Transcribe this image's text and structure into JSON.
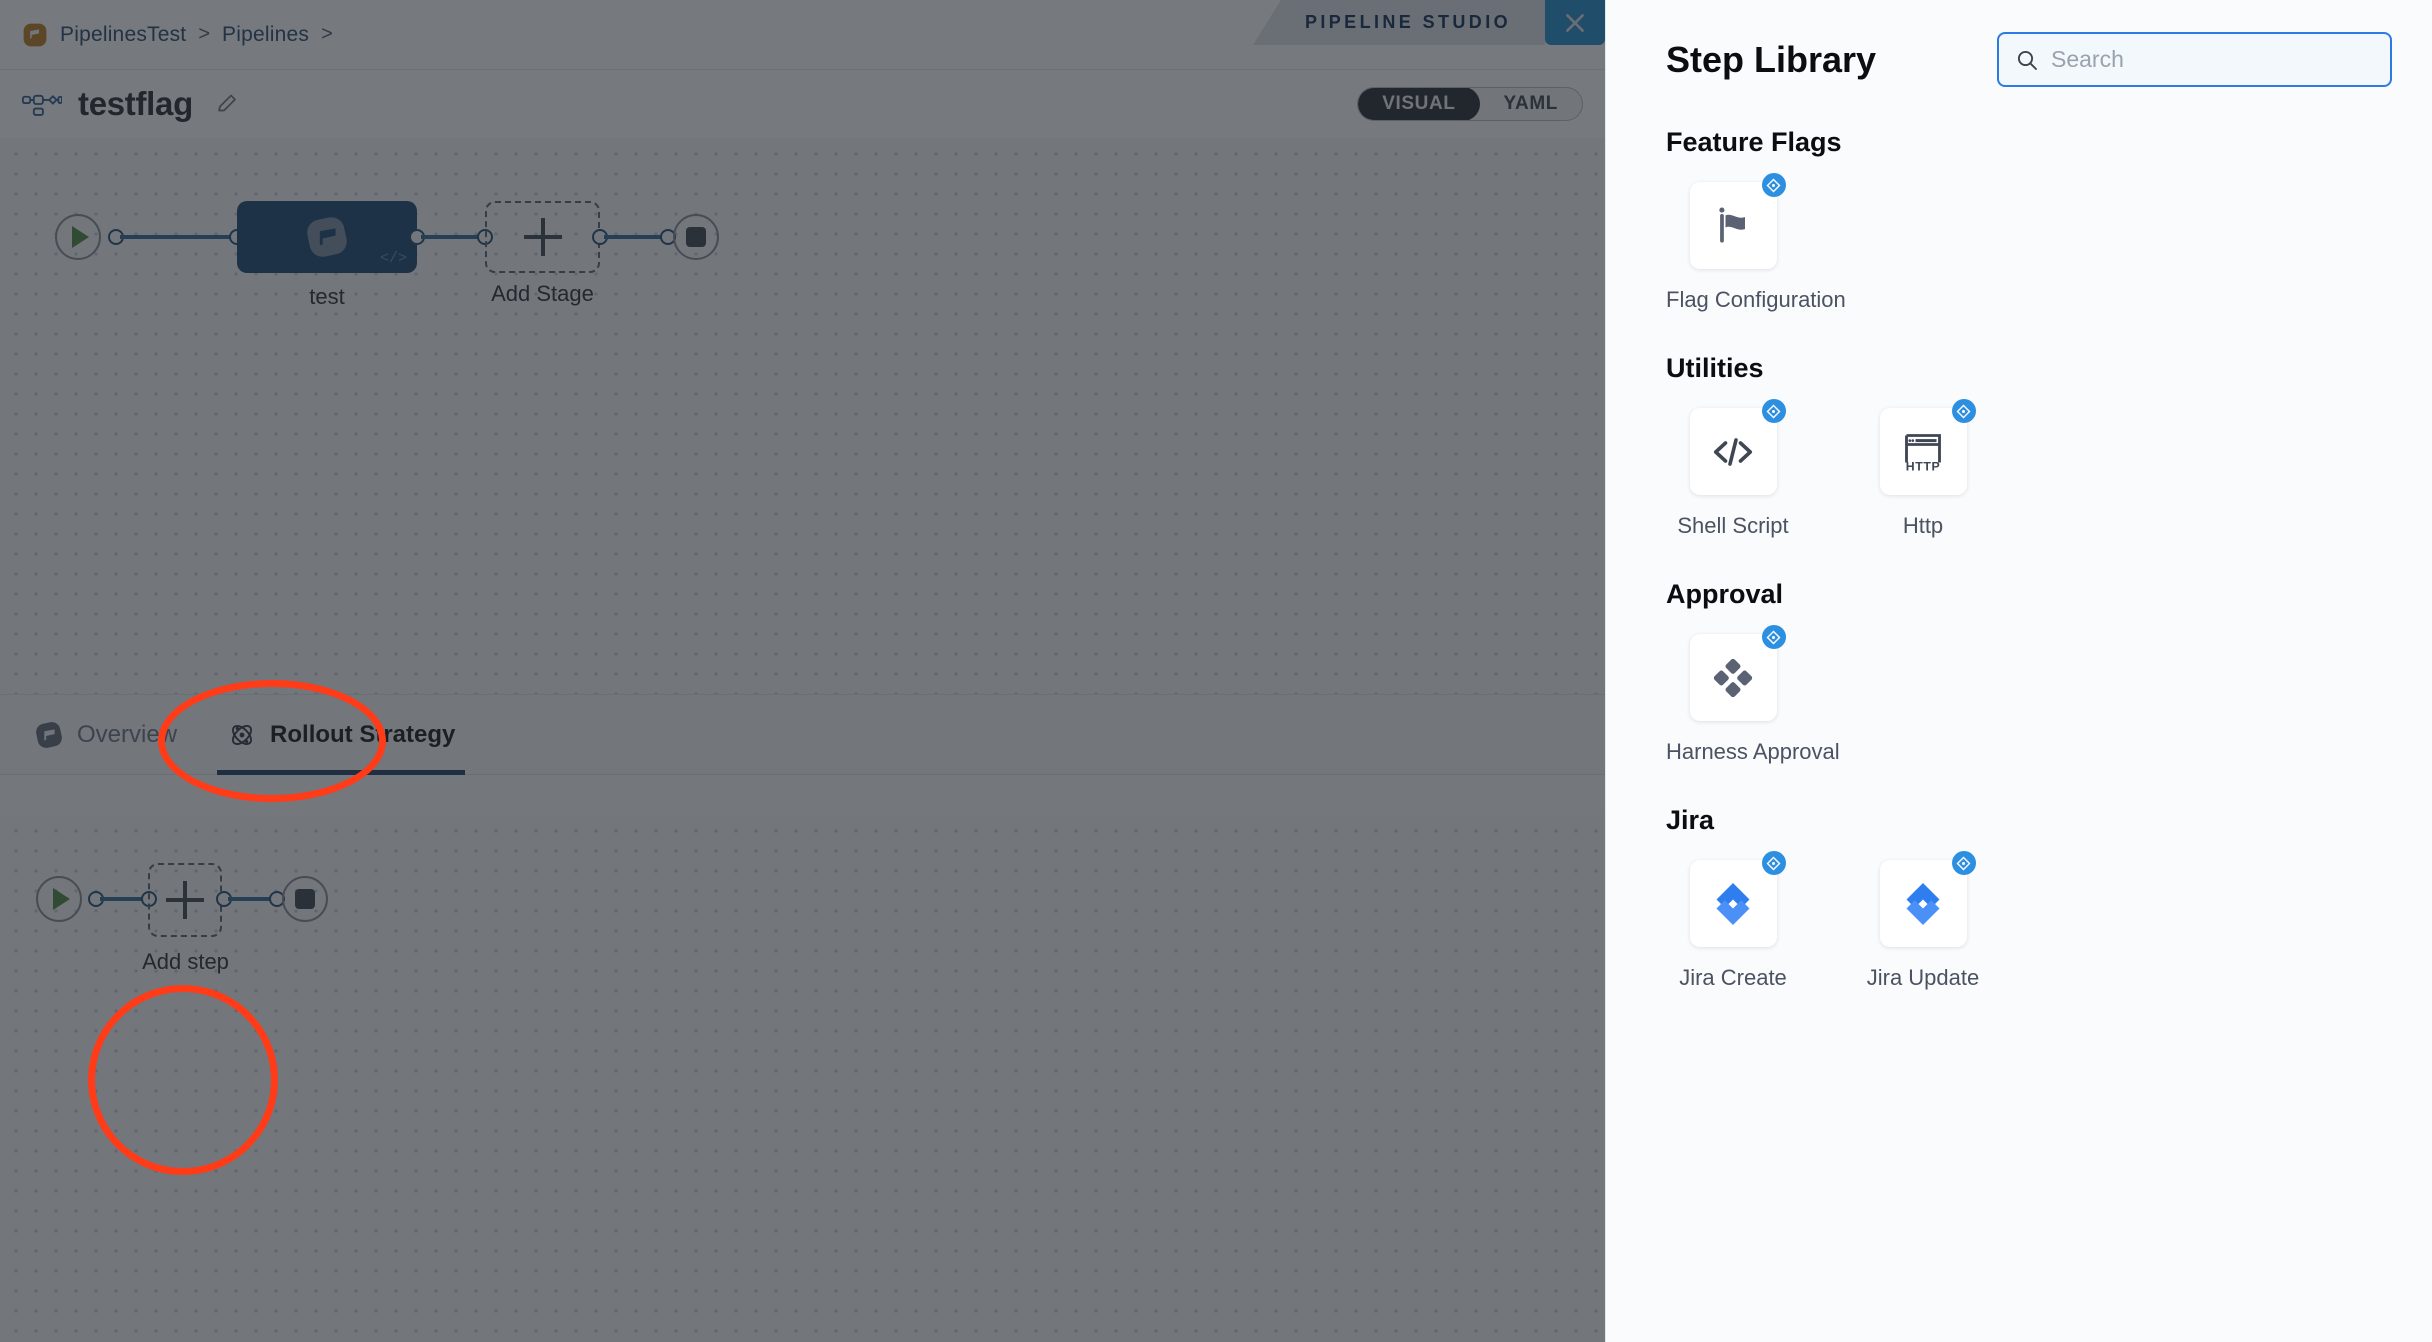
{
  "breadcrumb": {
    "logo_icon": "harness-logo-icon",
    "items": [
      "PipelinesTest",
      "Pipelines"
    ],
    "separator": ">",
    "trailing_separator": ">"
  },
  "studio_tag": {
    "label": "PIPELINE STUDIO",
    "close_icon": "close-icon",
    "close_bg": "#1e8ccb"
  },
  "title_row": {
    "pipeline_icon": "pipeline-nodes-icon",
    "name": "testflag",
    "edit_icon": "pencil-icon",
    "view_toggle": {
      "options": [
        "VISUAL",
        "YAML"
      ],
      "selected": "VISUAL"
    }
  },
  "stage_canvas": {
    "start_icon": "play-icon",
    "stage": {
      "label": "test",
      "icon": "feature-flag-icon",
      "code_badge": "</>",
      "color": "#1a4571"
    },
    "add_stage": {
      "label": "Add Stage",
      "icon": "plus-icon"
    },
    "end_icon": "stop-icon"
  },
  "stage_tabs": {
    "items": [
      {
        "label": "Overview",
        "icon": "feature-flag-icon",
        "active": false
      },
      {
        "label": "Rollout Strategy",
        "icon": "atom-icon",
        "active": true
      }
    ]
  },
  "step_canvas": {
    "start_icon": "play-icon",
    "add_step": {
      "label": "Add step",
      "icon": "plus-icon"
    },
    "end_icon": "stop-icon"
  },
  "annotations": {
    "color": "#ff3b18",
    "shapes": [
      {
        "target": "rollout-strategy-tab"
      },
      {
        "target": "add-step-node"
      }
    ]
  },
  "panel": {
    "title": "Step Library",
    "search": {
      "placeholder": "Search",
      "value": "",
      "icon": "search-icon",
      "border": "#2c7be5"
    },
    "badge_icon": "drag-move-icon",
    "sections": [
      {
        "title": "Feature Flags",
        "steps": [
          {
            "label": "Flag Configuration",
            "icon": "flag-icon"
          }
        ]
      },
      {
        "title": "Utilities",
        "steps": [
          {
            "label": "Shell Script",
            "icon": "code-icon"
          },
          {
            "label": "Http",
            "icon": "http-icon"
          }
        ]
      },
      {
        "title": "Approval",
        "steps": [
          {
            "label": "Harness Approval",
            "icon": "harness-diamond-icon"
          }
        ]
      },
      {
        "title": "Jira",
        "steps": [
          {
            "label": "Jira Create",
            "icon": "jira-icon"
          },
          {
            "label": "Jira Update",
            "icon": "jira-icon"
          }
        ]
      }
    ]
  }
}
